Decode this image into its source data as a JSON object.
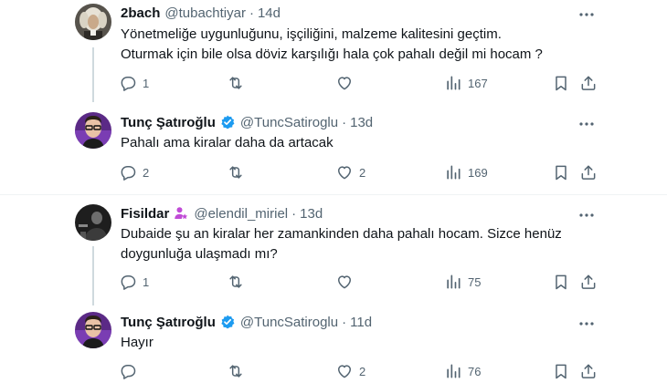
{
  "tweets": [
    {
      "name": "2bach",
      "handle": "@tubachtiyar",
      "time": "14d",
      "text_lines": [
        "Yönetmeliğe uygunluğunu, işçiliğini, malzeme kalitesini geçtim.",
        "Oturmak için bile olsa döviz karşılığı hala çok pahalı değil mi hocam ?"
      ],
      "replies": "1",
      "retweets": "",
      "likes": "",
      "views": "167"
    },
    {
      "name": "Tunç Şatıroğlu",
      "handle": "@TuncSatiroglu",
      "time": "13d",
      "verified": true,
      "text_lines": [
        "Pahalı ama kiralar daha da artacak"
      ],
      "replies": "2",
      "retweets": "",
      "likes": "2",
      "views": "169"
    },
    {
      "name": "Fisildar",
      "handle": "@elendil_miriel",
      "time": "13d",
      "text_lines": [
        "Dubaide şu an kiralar her zamankinden daha pahalı hocam. Sizce henüz",
        "doygunluğa ulaşmadı mı?"
      ],
      "replies": "1",
      "retweets": "",
      "likes": "",
      "views": "75"
    },
    {
      "name": "Tunç Şatıroğlu",
      "handle": "@TuncSatiroglu",
      "time": "11d",
      "verified": true,
      "text_lines": [
        "Hayır"
      ],
      "replies": "",
      "retweets": "",
      "likes": "2",
      "views": "76"
    }
  ],
  "colors": {
    "text": "#0f1419",
    "secondary": "#536471",
    "verified": "#1d9bf0",
    "thread_line": "#cfd9de",
    "divider": "#eff3f4",
    "user_badge": "#c04bd6"
  },
  "icons": [
    "more-icon",
    "reply-icon",
    "retweet-icon",
    "like-icon",
    "views-icon",
    "bookmark-icon",
    "share-icon",
    "verified-badge-icon",
    "user-badge-icon"
  ]
}
